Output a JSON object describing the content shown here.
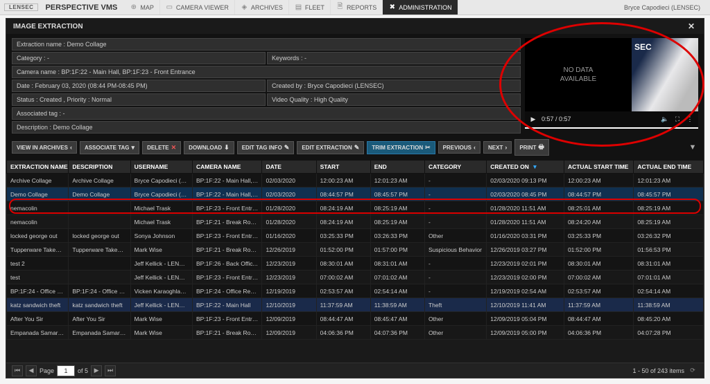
{
  "topbar": {
    "brand": "LENSEC",
    "app": "PERSPECTIVE VMS",
    "tabs": [
      {
        "label": "MAP",
        "icon": "⊕"
      },
      {
        "label": "CAMERA VIEWER",
        "icon": "▭"
      },
      {
        "label": "ARCHIVES",
        "icon": "◈"
      },
      {
        "label": "FLEET",
        "icon": "▤"
      },
      {
        "label": "REPORTS",
        "icon": "🗎"
      },
      {
        "label": "ADMINISTRATION",
        "icon": "✖"
      }
    ],
    "activeTab": 5,
    "user": "Bryce Capodieci (LENSEC)"
  },
  "window": {
    "title": "IMAGE EXTRACTION",
    "close": "✕"
  },
  "details": {
    "extraction_name_lbl": "Extraction name : Demo Collage",
    "category_lbl": "Category : -",
    "keywords_lbl": "Keywords : -",
    "camera_lbl": "Camera name : BP:1F:22 - Main Hall, BP:1F:23 - Front Entrance",
    "date_lbl": "Date : February 03, 2020 (08:44 PM-08:45 PM)",
    "createdby_lbl": "Created by : Bryce Capodieci (LENSEC)",
    "status_lbl": "Status : Created ,   Priority : Normal",
    "quality_lbl": "Video Quality : High Quality",
    "tag_lbl": "Associated tag : -",
    "desc_lbl": "Description : Demo Collage"
  },
  "video": {
    "nodata": "NO DATA\nAVAILABLE",
    "logo_hint": "SEC",
    "play_icon": "▶",
    "time": "0:57 / 0:57",
    "vol_icon": "🔈",
    "full_icon": "⛶",
    "more_icon": "⋮"
  },
  "toolbar": {
    "view": "VIEW IN ARCHIVES",
    "assoc": "ASSOCIATE TAG",
    "del": "DELETE",
    "dl": "DOWNLOAD",
    "edittag": "EDIT TAG INFO",
    "editext": "EDIT EXTRACTION",
    "trim": "TRIM EXTRACTION",
    "prev": "PREVIOUS",
    "next": "NEXT",
    "print": "PRINT"
  },
  "grid": {
    "headers": [
      "EXTRACTION NAME",
      "DESCRIPTION",
      "USERNAME",
      "CAMERA NAME",
      "DATE",
      "START",
      "END",
      "CATEGORY",
      "CREATED ON",
      "ACTUAL START TIME",
      "ACTUAL END TIME"
    ],
    "sortedCol": 8,
    "rows": [
      [
        "Archive Collage",
        "Archive Collage",
        "Bryce Capodieci (LEN...",
        "BP:1F:22 - Main Hall, ...",
        "02/03/2020",
        "12:00:23 AM",
        "12:01:23 AM",
        "-",
        "02/03/2020 09:13 PM",
        "12:00:23 AM",
        "12:01:23 AM"
      ],
      [
        "Demo Collage",
        "Demo Collage",
        "Bryce Capodieci (LEN...",
        "BP:1F:22 - Main Hall, ...",
        "02/03/2020",
        "08:44:57 PM",
        "08:45:57 PM",
        "-",
        "02/03/2020 08:45 PM",
        "08:44:57 PM",
        "08:45:57 PM"
      ],
      [
        "nemacolin",
        "",
        "Michael Trask",
        "BP:1F:23 - Front Entra...",
        "01/28/2020",
        "08:24:19 AM",
        "08:25:19 AM",
        "-",
        "01/28/2020 11:51 AM",
        "08:25:01 AM",
        "08:25:19 AM"
      ],
      [
        "nemacolin",
        "",
        "Michael Trask",
        "BP:1F:21 - Break Room",
        "01/28/2020",
        "08:24:19 AM",
        "08:25:19 AM",
        "-",
        "01/28/2020 11:51 AM",
        "08:24:20 AM",
        "08:25:19 AM"
      ],
      [
        "locked george out",
        "locked george out",
        "Sonya Johnson",
        "BP:1F:23 - Front Entra...",
        "01/16/2020",
        "03:25:33 PM",
        "03:26:33 PM",
        "Other",
        "01/16/2020 03:31 PM",
        "03:25:33 PM",
        "03:26:32 PM"
      ],
      [
        "Tupperware Takedown",
        "Tupperware Takedown",
        "Mark Wise",
        "BP:1F:21 - Break Room",
        "12/26/2019",
        "01:52:00 PM",
        "01:57:00 PM",
        "Suspicious Behavior",
        "12/26/2019 03:27 PM",
        "01:52:00 PM",
        "01:56:53 PM"
      ],
      [
        "test 2",
        "",
        "Jeff Kellick - LENSEC",
        "BP:1F:26 - Back Offic...",
        "12/23/2019",
        "08:30:01 AM",
        "08:31:01 AM",
        "-",
        "12/23/2019 02:01 PM",
        "08:30:01 AM",
        "08:31:01 AM"
      ],
      [
        "test",
        "",
        "Jeff Kellick - LENSEC",
        "BP:1F:23 - Front Entra...",
        "12/23/2019",
        "07:00:02 AM",
        "07:01:02 AM",
        "-",
        "12/23/2019 02:00 PM",
        "07:00:02 AM",
        "07:01:01 AM"
      ],
      [
        "BP:1F:24 - Office Rear...",
        "BP:1F:24 - Office Rea...",
        "Vicken Karaoghlanian...",
        "BP:1F:24 - Office Rear...",
        "12/19/2019",
        "02:53:57 AM",
        "02:54:14 AM",
        "-",
        "12/19/2019 02:54 AM",
        "02:53:57 AM",
        "02:54:14 AM"
      ],
      [
        "katz sandwich theft",
        "katz sandwich theft",
        "Jeff Kellick - LENSEC",
        "BP:1F:22 - Main Hall",
        "12/10/2019",
        "11:37:59 AM",
        "11:38:59 AM",
        "Theft",
        "12/10/2019 11:41 AM",
        "11:37:59 AM",
        "11:38:59 AM"
      ],
      [
        "After You Sir",
        "After You Sir",
        "Mark Wise",
        "BP:1F:23 - Front Entra...",
        "12/09/2019",
        "08:44:47 AM",
        "08:45:47 AM",
        "Other",
        "12/09/2019 05:04 PM",
        "08:44:47 AM",
        "08:45:20 AM"
      ],
      [
        "Empanada Samaritan",
        "Empanada Samaritan",
        "Mark Wise",
        "BP:1F:21 - Break Room",
        "12/09/2019",
        "04:06:36 PM",
        "04:07:36 PM",
        "Other",
        "12/09/2019 05:00 PM",
        "04:06:36 PM",
        "04:07:28 PM"
      ]
    ],
    "selectedRow": 1
  },
  "pager": {
    "page": "1",
    "of": "of 5",
    "summary": "1 - 50 of 243 items"
  }
}
